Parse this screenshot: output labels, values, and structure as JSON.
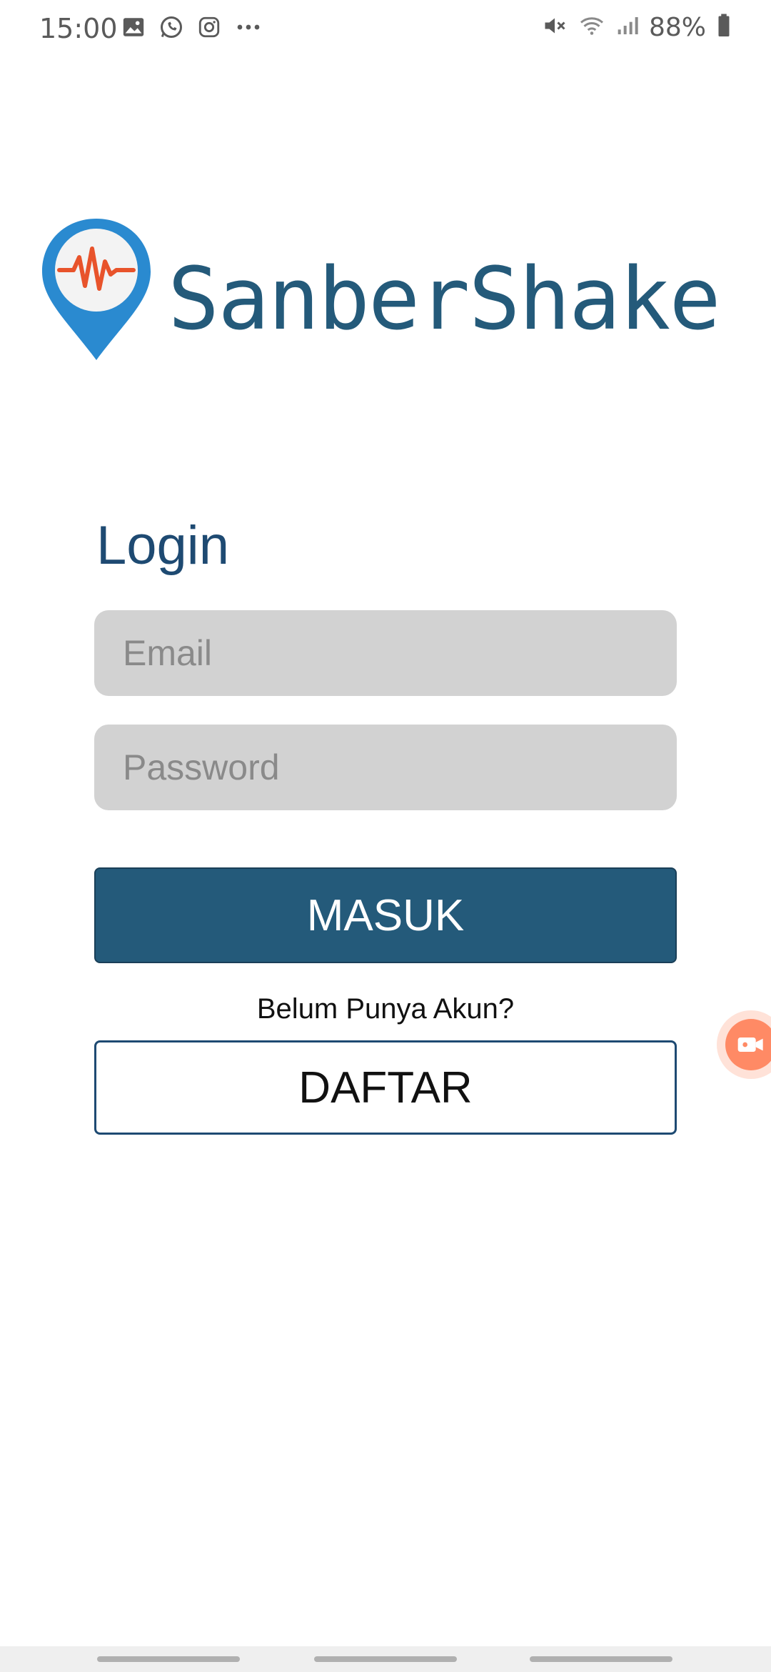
{
  "status_bar": {
    "time": "15:00",
    "battery": "88%",
    "left_icons": [
      "image-icon",
      "whatsapp-icon",
      "instagram-icon",
      "more-dots-icon"
    ],
    "right_icons": [
      "mute-icon",
      "wifi-icon",
      "signal-icon",
      "battery-icon"
    ]
  },
  "app": {
    "name": "SanberShake",
    "logo_icon": "map-pin-heartbeat-icon",
    "brand_color": "#245a7a",
    "pin_color": "#2a8ad0",
    "pulse_color": "#e8532b"
  },
  "login": {
    "title": "Login",
    "email_placeholder": "Email",
    "password_placeholder": "Password",
    "submit_label": "MASUK",
    "no_account_prompt": "Belum Punya Akun?",
    "register_label": "DAFTAR"
  },
  "overlay": {
    "recorder_icon": "video-camera-icon"
  }
}
